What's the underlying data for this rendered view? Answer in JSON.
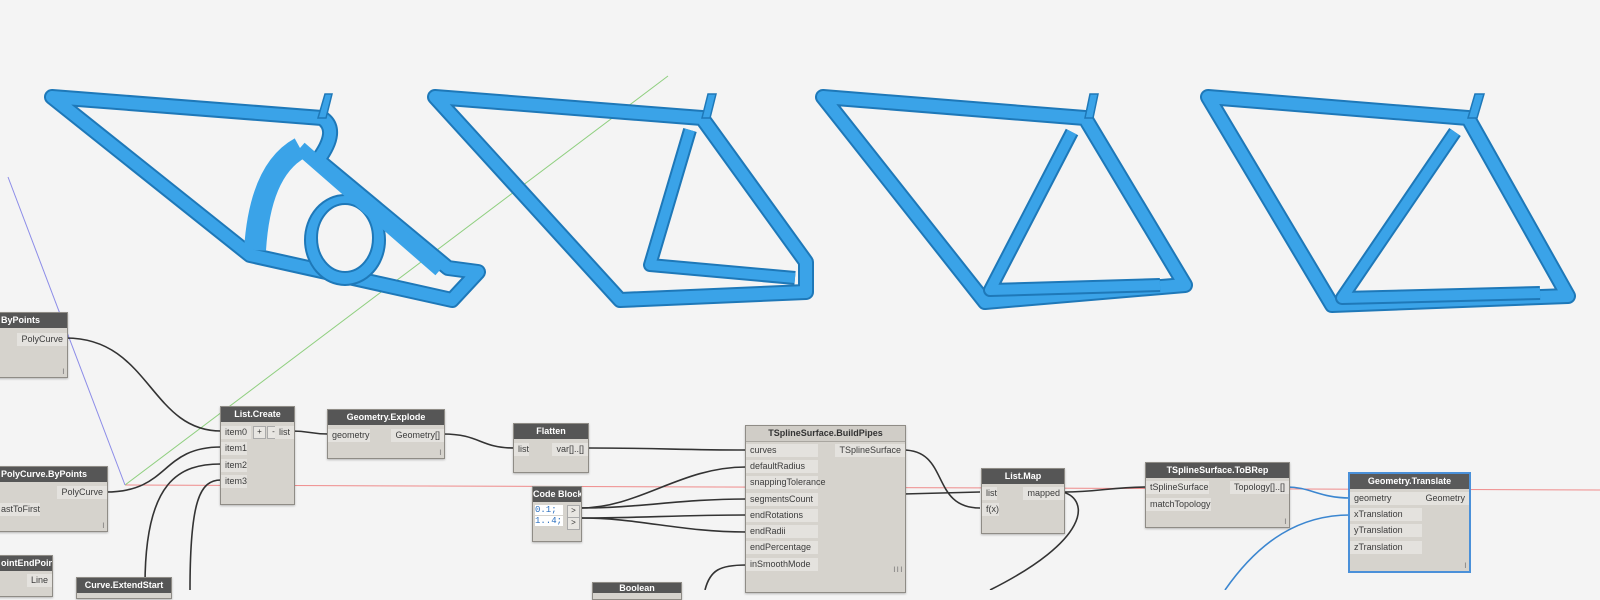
{
  "colors": {
    "frame": "#3aa3e8",
    "frame_dark": "#1e78b8",
    "wire": "#333333",
    "wire_selected": "#3b86d0",
    "axis_x": "#ef8b8b",
    "axis_y": "#8fcf7f",
    "axis_z": "#8c8ce8",
    "canvas": "#f4f4f4"
  },
  "nodes": {
    "polycurve_bypoints_a": {
      "title": "ByPoints",
      "out": "PolyCurve",
      "lace": "l"
    },
    "polycurve_bypoints_b": {
      "title": "PolyCurve.ByPoints",
      "out": "PolyCurve",
      "in": "astToFirst",
      "lace": "l"
    },
    "endpoint": {
      "title": "ointEndPoint",
      "out": "Line"
    },
    "extend_start": {
      "title": "Curve.ExtendStart"
    },
    "boolean": {
      "title": "Boolean"
    },
    "list_create": {
      "title": "List.Create",
      "inputs": [
        "item0",
        "item1",
        "item2",
        "item3"
      ],
      "out": "list",
      "add": "+",
      "remove": "-"
    },
    "explode": {
      "title": "Geometry.Explode",
      "in": "geometry",
      "out": "Geometry[]",
      "lace": "l"
    },
    "flatten": {
      "title": "Flatten",
      "in": "list",
      "out": "var[]..[]"
    },
    "code_block": {
      "title": "Code Block",
      "lines": [
        "0.1;",
        "1..4;"
      ],
      "port": ">"
    },
    "build_pipes": {
      "title": "TSplineSurface.BuildPipes",
      "inputs": [
        "curves",
        "defaultRadius",
        "snappingTolerance",
        "segmentsCount",
        "endRotations",
        "endRadii",
        "endPercentage",
        "inSmoothMode"
      ],
      "out": "TSplineSurface",
      "lace": "l l l"
    },
    "list_map": {
      "title": "List.Map",
      "inputs": [
        "list",
        "f(x)"
      ],
      "out": "mapped"
    },
    "tobrep": {
      "title": "TSplineSurface.ToBRep",
      "inputs": [
        "tSplineSurface",
        "matchTopology"
      ],
      "out": "Topology[]..[]",
      "lace": "l"
    },
    "translate": {
      "title": "Geometry.Translate",
      "inputs": [
        "geometry",
        "xTranslation",
        "yTranslation",
        "zTranslation"
      ],
      "out": "Geometry",
      "lace": "l"
    }
  }
}
